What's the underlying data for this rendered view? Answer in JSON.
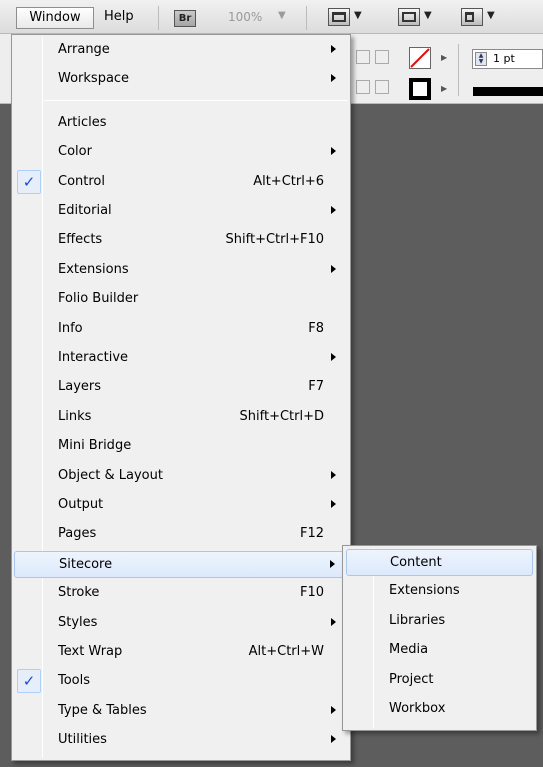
{
  "menubar": {
    "window_label": "Window",
    "help_label": "Help",
    "bridge_label": "Br",
    "zoom_value": "100%"
  },
  "control_panel": {
    "stroke_weight": "1 pt"
  },
  "window_menu": {
    "items": [
      {
        "label": "Arrange",
        "shortcut": "",
        "submenu": true,
        "checked": false
      },
      {
        "label": "Workspace",
        "shortcut": "",
        "submenu": true,
        "checked": false
      },
      {
        "label": "Articles",
        "shortcut": "",
        "submenu": false,
        "checked": false
      },
      {
        "label": "Color",
        "shortcut": "",
        "submenu": true,
        "checked": false
      },
      {
        "label": "Control",
        "shortcut": "Alt+Ctrl+6",
        "submenu": false,
        "checked": true
      },
      {
        "label": "Editorial",
        "shortcut": "",
        "submenu": true,
        "checked": false
      },
      {
        "label": "Effects",
        "shortcut": "Shift+Ctrl+F10",
        "submenu": false,
        "checked": false
      },
      {
        "label": "Extensions",
        "shortcut": "",
        "submenu": true,
        "checked": false
      },
      {
        "label": "Folio Builder",
        "shortcut": "",
        "submenu": false,
        "checked": false
      },
      {
        "label": "Info",
        "shortcut": "F8",
        "submenu": false,
        "checked": false
      },
      {
        "label": "Interactive",
        "shortcut": "",
        "submenu": true,
        "checked": false
      },
      {
        "label": "Layers",
        "shortcut": "F7",
        "submenu": false,
        "checked": false
      },
      {
        "label": "Links",
        "shortcut": "Shift+Ctrl+D",
        "submenu": false,
        "checked": false
      },
      {
        "label": "Mini Bridge",
        "shortcut": "",
        "submenu": false,
        "checked": false
      },
      {
        "label": "Object & Layout",
        "shortcut": "",
        "submenu": true,
        "checked": false
      },
      {
        "label": "Output",
        "shortcut": "",
        "submenu": true,
        "checked": false
      },
      {
        "label": "Pages",
        "shortcut": "F12",
        "submenu": false,
        "checked": false
      },
      {
        "label": "Sitecore",
        "shortcut": "",
        "submenu": true,
        "checked": false,
        "highlighted": true
      },
      {
        "label": "Stroke",
        "shortcut": "F10",
        "submenu": false,
        "checked": false
      },
      {
        "label": "Styles",
        "shortcut": "",
        "submenu": true,
        "checked": false
      },
      {
        "label": "Text Wrap",
        "shortcut": "Alt+Ctrl+W",
        "submenu": false,
        "checked": false
      },
      {
        "label": "Tools",
        "shortcut": "",
        "submenu": false,
        "checked": true
      },
      {
        "label": "Type & Tables",
        "shortcut": "",
        "submenu": true,
        "checked": false
      },
      {
        "label": "Utilities",
        "shortcut": "",
        "submenu": true,
        "checked": false
      }
    ],
    "check_glyph": "✓"
  },
  "sitecore_submenu": {
    "items": [
      {
        "label": "Content",
        "highlighted": true
      },
      {
        "label": "Extensions",
        "highlighted": false
      },
      {
        "label": "Libraries",
        "highlighted": false
      },
      {
        "label": "Media",
        "highlighted": false
      },
      {
        "label": "Project",
        "highlighted": false
      },
      {
        "label": "Workbox",
        "highlighted": false
      }
    ]
  },
  "colors": {
    "highlight_border": "#a9c7ee",
    "check_color": "#1b4fd0",
    "menu_bg": "#f0f0f0"
  }
}
